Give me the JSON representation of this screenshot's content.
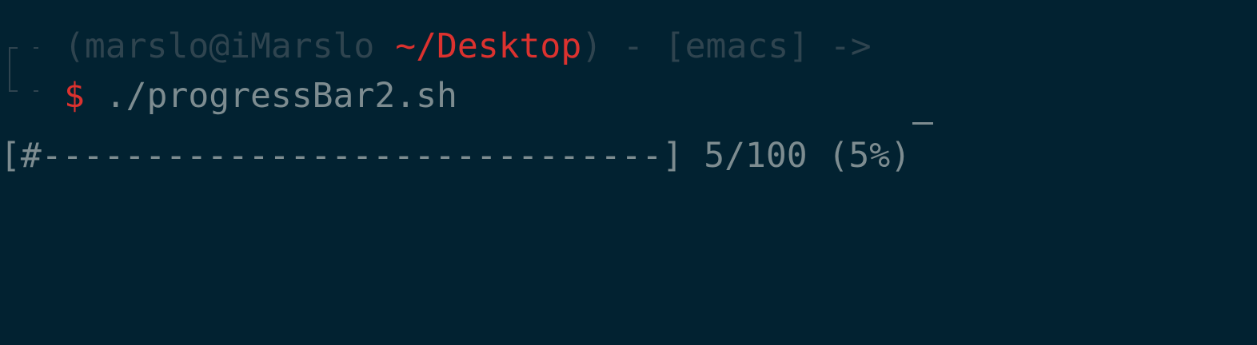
{
  "prompt": {
    "open_paren": "(",
    "user_host": "marslo@iMarslo",
    "cwd": "~/Desktop",
    "close_paren": ")",
    "separator": " - ",
    "context": "[emacs]",
    "arrow": " ->",
    "symbol": "$",
    "command": "./progressBar2.sh"
  },
  "output": {
    "progress_bar": "[#------------------------------]",
    "progress_text": "5/100 (5%)",
    "progress_fraction": 0.05
  },
  "colors": {
    "background": "#022231",
    "foreground": "#7d8c90",
    "dim": "#2f444f",
    "accent_red": "#dc322f"
  },
  "icons": {
    "prompt_bracket": "corner-bracket-icon",
    "cursor": "underscore-cursor"
  }
}
